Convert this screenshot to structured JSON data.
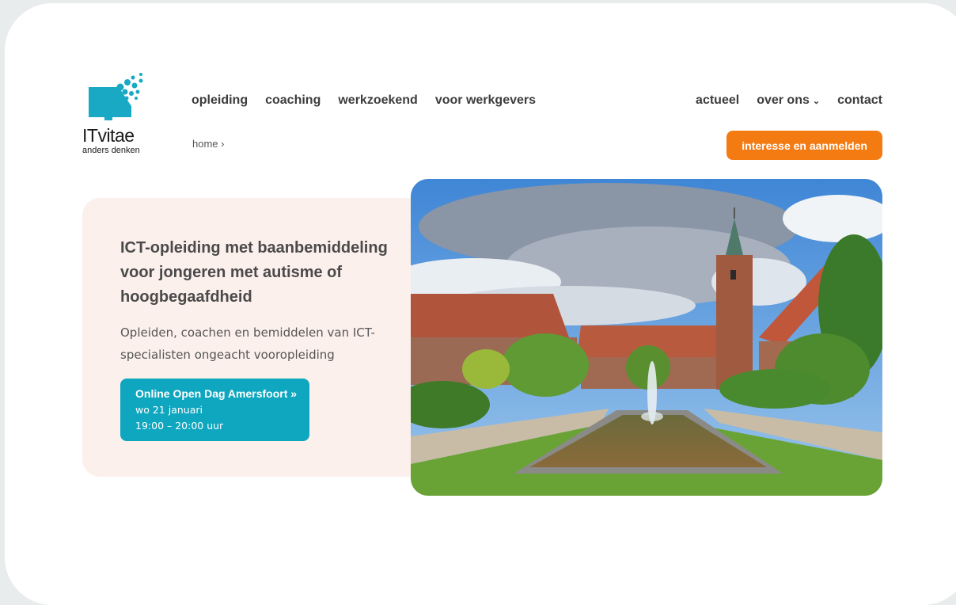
{
  "logo": {
    "name": "ITvitae",
    "tagline": "anders denken",
    "colors": {
      "primary": "#19a9c4"
    }
  },
  "nav": {
    "left": [
      {
        "label": "opleiding"
      },
      {
        "label": "coaching"
      },
      {
        "label": "werkzoekend"
      },
      {
        "label": "voor werkgevers"
      }
    ],
    "right": [
      {
        "label": "actueel"
      },
      {
        "label": "over ons",
        "icon": "chevron-down-icon"
      },
      {
        "label": "contact"
      }
    ]
  },
  "breadcrumb": {
    "label": "home ›"
  },
  "cta": {
    "label": "interesse en aanmelden",
    "color": "#f47a12"
  },
  "hero": {
    "title": "ICT-opleiding met baanbemiddeling voor jongeren met autisme of hoogbegaafdheid",
    "subtitle": "Opleiden, coachen en bemiddelen van ICT-specialisten ongeacht vooropleiding",
    "background": "#fcf0ec",
    "open_day": {
      "title": "Online Open Dag Amersfoort »",
      "date": "wo 21 januari",
      "time": "19:00 – 20:00 uur",
      "color": "#0fa6bf"
    },
    "image": "campus-courtyard-with-fountain-and-church-tower"
  }
}
